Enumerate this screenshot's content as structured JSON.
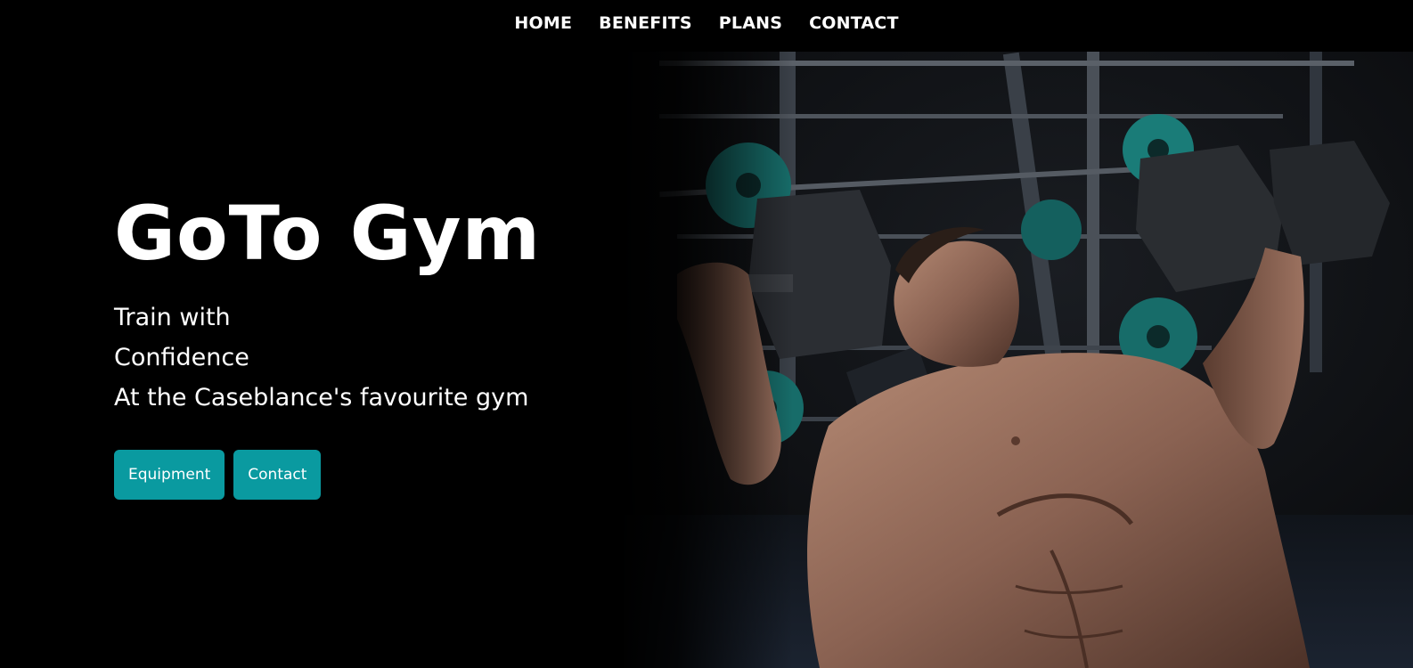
{
  "nav": {
    "items": [
      {
        "label": "HOME"
      },
      {
        "label": "BENEFITS"
      },
      {
        "label": "PLANS"
      },
      {
        "label": "CONTACT"
      }
    ]
  },
  "hero": {
    "title": "GoTo Gym",
    "lines": [
      "Train with",
      "Confidence",
      "At the Caseblance's favourite gym"
    ],
    "buttons": {
      "equipment_label": "Equipment",
      "contact_label": "Contact"
    },
    "image_subject": "man-bench-pressing-dumbbells"
  },
  "colors": {
    "background": "#000000",
    "accent": "#0a9aa0",
    "text": "#ffffff"
  }
}
